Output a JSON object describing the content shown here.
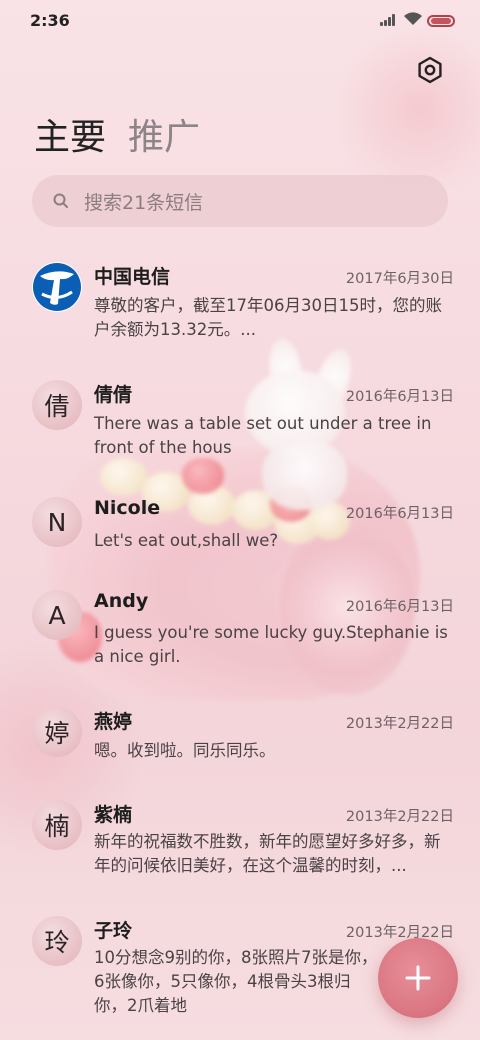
{
  "status_bar": {
    "time": "2:36"
  },
  "tabs": {
    "main_label": "主要",
    "promo_label": "推广"
  },
  "search": {
    "placeholder": "搜索21条短信"
  },
  "conversations": [
    {
      "avatar_text": "",
      "avatar_icon": "china-telecom-logo",
      "name": "中国电信",
      "date": "2017年6月30日",
      "preview": "尊敬的客户，截至17年06月30日15时，您的账户余额为13.32元。..."
    },
    {
      "avatar_text": "倩",
      "name": "倩倩",
      "date": "2016年6月13日",
      "preview": "There was a table set out under a tree in front of the hous"
    },
    {
      "avatar_text": "N",
      "name": "Nicole",
      "date": "2016年6月13日",
      "preview": "Let's eat out,shall we?"
    },
    {
      "avatar_text": "A",
      "name": "Andy",
      "date": "2016年6月13日",
      "preview": "I guess you're some lucky guy.Stephanie is a nice girl."
    },
    {
      "avatar_text": "婷",
      "name": "燕婷",
      "date": "2013年2月22日",
      "preview": "嗯。收到啦。同乐同乐。"
    },
    {
      "avatar_text": "楠",
      "name": "紫楠",
      "date": "2013年2月22日",
      "preview": "新年的祝福数不胜数，新年的愿望好多好多，新年的问候依旧美好，在这个温馨的时刻，..."
    },
    {
      "avatar_text": "玲",
      "name": "子玲",
      "date": "2013年2月22日",
      "preview": "10分想念9别的你，8张照片7张是你，6张像你，5只像你，4根骨头3根归你，2爪着地"
    }
  ],
  "colors": {
    "accent": "#d97581",
    "battery": "#c6545d",
    "background": "#f6dadf",
    "telecom_blue": "#0a5fb4"
  },
  "icons": {
    "settings": "gear-icon",
    "search": "search-icon",
    "compose": "plus-icon"
  }
}
